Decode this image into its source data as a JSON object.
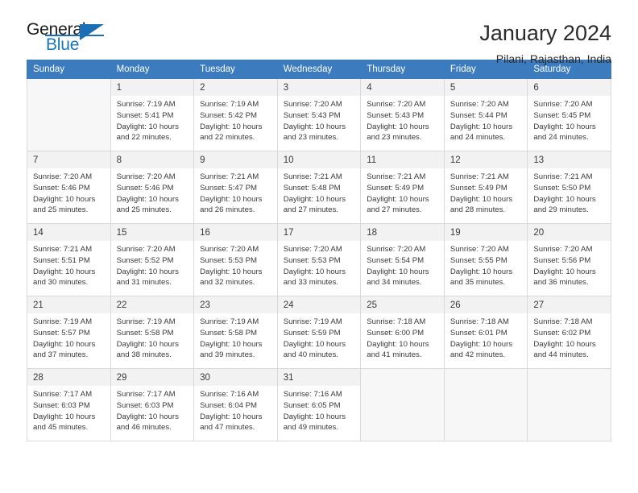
{
  "brand": {
    "name_part1": "General",
    "name_part2": "Blue",
    "logo_icon": "triangle-play-icon",
    "accent_color": "#1b6fb5"
  },
  "header": {
    "title": "January 2024",
    "location": "Pilani, Rajasthan, India"
  },
  "calendar": {
    "header_bg": "#3c7cbe",
    "weekday_headers": [
      "Sunday",
      "Monday",
      "Tuesday",
      "Wednesday",
      "Thursday",
      "Friday",
      "Saturday"
    ],
    "weeks": [
      [
        {
          "day": "",
          "detail": ""
        },
        {
          "day": "1",
          "detail": "Sunrise: 7:19 AM\nSunset: 5:41 PM\nDaylight: 10 hours\nand 22 minutes."
        },
        {
          "day": "2",
          "detail": "Sunrise: 7:19 AM\nSunset: 5:42 PM\nDaylight: 10 hours\nand 22 minutes."
        },
        {
          "day": "3",
          "detail": "Sunrise: 7:20 AM\nSunset: 5:43 PM\nDaylight: 10 hours\nand 23 minutes."
        },
        {
          "day": "4",
          "detail": "Sunrise: 7:20 AM\nSunset: 5:43 PM\nDaylight: 10 hours\nand 23 minutes."
        },
        {
          "day": "5",
          "detail": "Sunrise: 7:20 AM\nSunset: 5:44 PM\nDaylight: 10 hours\nand 24 minutes."
        },
        {
          "day": "6",
          "detail": "Sunrise: 7:20 AM\nSunset: 5:45 PM\nDaylight: 10 hours\nand 24 minutes."
        }
      ],
      [
        {
          "day": "7",
          "detail": "Sunrise: 7:20 AM\nSunset: 5:46 PM\nDaylight: 10 hours\nand 25 minutes."
        },
        {
          "day": "8",
          "detail": "Sunrise: 7:20 AM\nSunset: 5:46 PM\nDaylight: 10 hours\nand 25 minutes."
        },
        {
          "day": "9",
          "detail": "Sunrise: 7:21 AM\nSunset: 5:47 PM\nDaylight: 10 hours\nand 26 minutes."
        },
        {
          "day": "10",
          "detail": "Sunrise: 7:21 AM\nSunset: 5:48 PM\nDaylight: 10 hours\nand 27 minutes."
        },
        {
          "day": "11",
          "detail": "Sunrise: 7:21 AM\nSunset: 5:49 PM\nDaylight: 10 hours\nand 27 minutes."
        },
        {
          "day": "12",
          "detail": "Sunrise: 7:21 AM\nSunset: 5:49 PM\nDaylight: 10 hours\nand 28 minutes."
        },
        {
          "day": "13",
          "detail": "Sunrise: 7:21 AM\nSunset: 5:50 PM\nDaylight: 10 hours\nand 29 minutes."
        }
      ],
      [
        {
          "day": "14",
          "detail": "Sunrise: 7:21 AM\nSunset: 5:51 PM\nDaylight: 10 hours\nand 30 minutes."
        },
        {
          "day": "15",
          "detail": "Sunrise: 7:20 AM\nSunset: 5:52 PM\nDaylight: 10 hours\nand 31 minutes."
        },
        {
          "day": "16",
          "detail": "Sunrise: 7:20 AM\nSunset: 5:53 PM\nDaylight: 10 hours\nand 32 minutes."
        },
        {
          "day": "17",
          "detail": "Sunrise: 7:20 AM\nSunset: 5:53 PM\nDaylight: 10 hours\nand 33 minutes."
        },
        {
          "day": "18",
          "detail": "Sunrise: 7:20 AM\nSunset: 5:54 PM\nDaylight: 10 hours\nand 34 minutes."
        },
        {
          "day": "19",
          "detail": "Sunrise: 7:20 AM\nSunset: 5:55 PM\nDaylight: 10 hours\nand 35 minutes."
        },
        {
          "day": "20",
          "detail": "Sunrise: 7:20 AM\nSunset: 5:56 PM\nDaylight: 10 hours\nand 36 minutes."
        }
      ],
      [
        {
          "day": "21",
          "detail": "Sunrise: 7:19 AM\nSunset: 5:57 PM\nDaylight: 10 hours\nand 37 minutes."
        },
        {
          "day": "22",
          "detail": "Sunrise: 7:19 AM\nSunset: 5:58 PM\nDaylight: 10 hours\nand 38 minutes."
        },
        {
          "day": "23",
          "detail": "Sunrise: 7:19 AM\nSunset: 5:58 PM\nDaylight: 10 hours\nand 39 minutes."
        },
        {
          "day": "24",
          "detail": "Sunrise: 7:19 AM\nSunset: 5:59 PM\nDaylight: 10 hours\nand 40 minutes."
        },
        {
          "day": "25",
          "detail": "Sunrise: 7:18 AM\nSunset: 6:00 PM\nDaylight: 10 hours\nand 41 minutes."
        },
        {
          "day": "26",
          "detail": "Sunrise: 7:18 AM\nSunset: 6:01 PM\nDaylight: 10 hours\nand 42 minutes."
        },
        {
          "day": "27",
          "detail": "Sunrise: 7:18 AM\nSunset: 6:02 PM\nDaylight: 10 hours\nand 44 minutes."
        }
      ],
      [
        {
          "day": "28",
          "detail": "Sunrise: 7:17 AM\nSunset: 6:03 PM\nDaylight: 10 hours\nand 45 minutes."
        },
        {
          "day": "29",
          "detail": "Sunrise: 7:17 AM\nSunset: 6:03 PM\nDaylight: 10 hours\nand 46 minutes."
        },
        {
          "day": "30",
          "detail": "Sunrise: 7:16 AM\nSunset: 6:04 PM\nDaylight: 10 hours\nand 47 minutes."
        },
        {
          "day": "31",
          "detail": "Sunrise: 7:16 AM\nSunset: 6:05 PM\nDaylight: 10 hours\nand 49 minutes."
        },
        {
          "day": "",
          "detail": ""
        },
        {
          "day": "",
          "detail": ""
        },
        {
          "day": "",
          "detail": ""
        }
      ]
    ]
  }
}
